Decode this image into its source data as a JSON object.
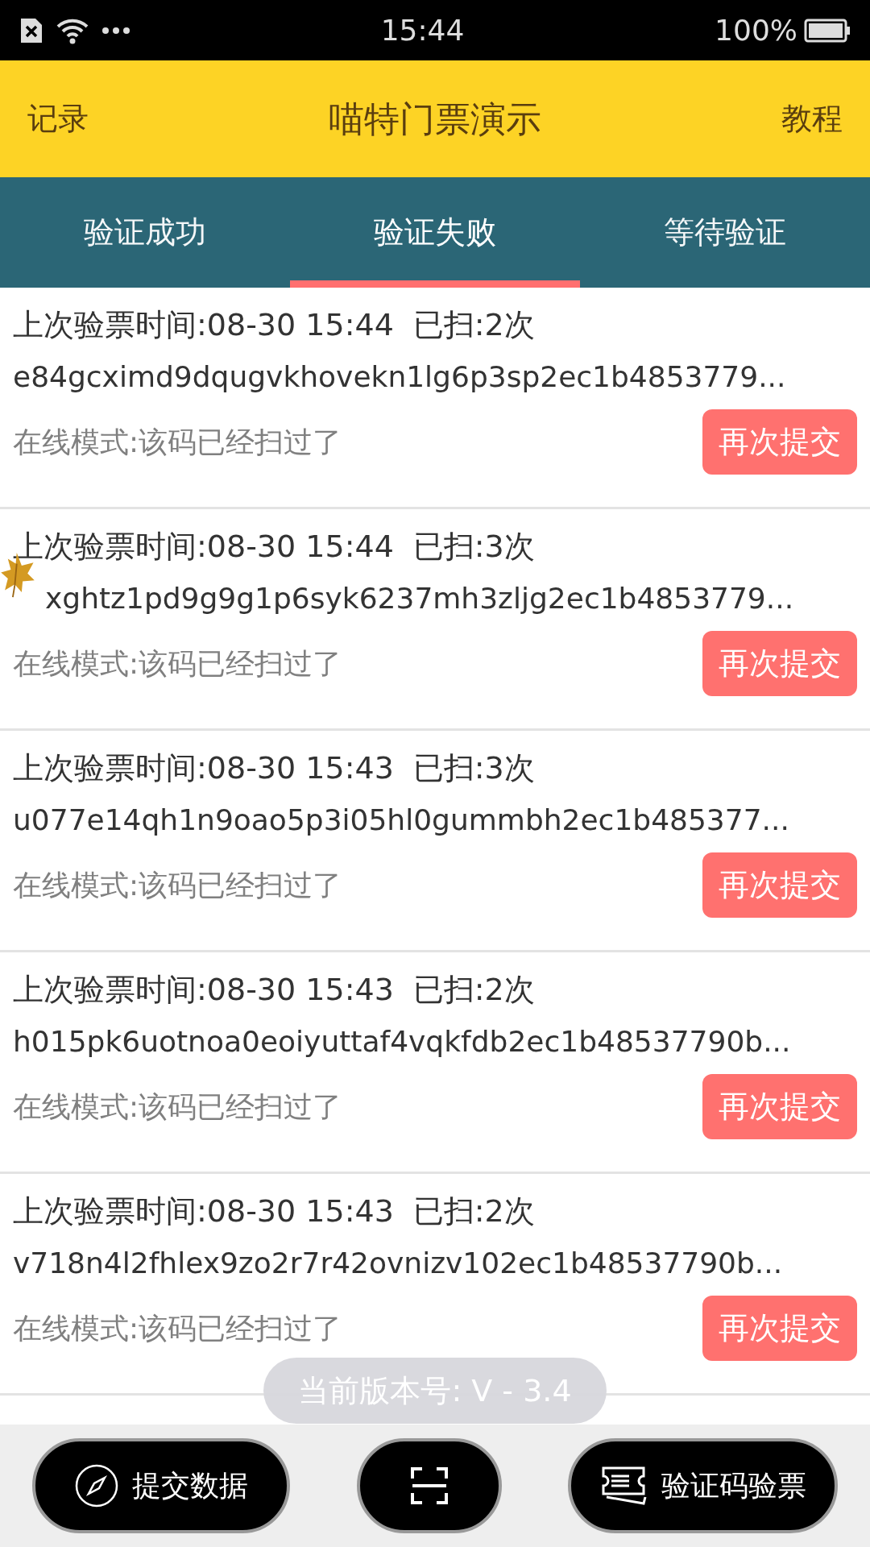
{
  "status_bar": {
    "time": "15:44",
    "battery": "100%"
  },
  "header": {
    "left": "记录",
    "title": "喵特门票演示",
    "right": "教程"
  },
  "tabs": [
    {
      "label": "验证成功",
      "selected": false
    },
    {
      "label": "验证失败",
      "selected": true
    },
    {
      "label": "等待验证",
      "selected": false
    }
  ],
  "records": [
    {
      "time": "上次验票时间:08-30 15:44",
      "count": "已扫:2次",
      "code": "e84gcximd9dqugvkhovekn1lg6p3sp2ec1b4853779...",
      "message": "在线模式:该码已经扫过了",
      "button": "再次提交"
    },
    {
      "time": "上次验票时间:08-30 15:44",
      "count": "已扫:3次",
      "code": "xghtz1pd9g9g1p6syk6237mh3zljg2ec1b4853779...",
      "message": "在线模式:该码已经扫过了",
      "button": "再次提交"
    },
    {
      "time": "上次验票时间:08-30 15:43",
      "count": "已扫:3次",
      "code": "u077e14qh1n9oao5p3i05hl0gummbh2ec1b485377...",
      "message": "在线模式:该码已经扫过了",
      "button": "再次提交"
    },
    {
      "time": "上次验票时间:08-30 15:43",
      "count": "已扫:2次",
      "code": "h015pk6uotnoa0eoiyuttaf4vqkfdb2ec1b48537790b...",
      "message": "在线模式:该码已经扫过了",
      "button": "再次提交"
    },
    {
      "time": "上次验票时间:08-30 15:43",
      "count": "已扫:2次",
      "code": "v718n4l2fhlex9zo2r7r42ovnizv102ec1b48537790b...",
      "message": "在线模式:该码已经扫过了",
      "button": "再次提交"
    }
  ],
  "toast": "当前版本号: V - 3.4",
  "bottom_buttons": [
    {
      "kind": "compass",
      "label": "提交数据"
    },
    {
      "kind": "scan"
    },
    {
      "kind": "ticket",
      "label": "验证码验票"
    }
  ]
}
